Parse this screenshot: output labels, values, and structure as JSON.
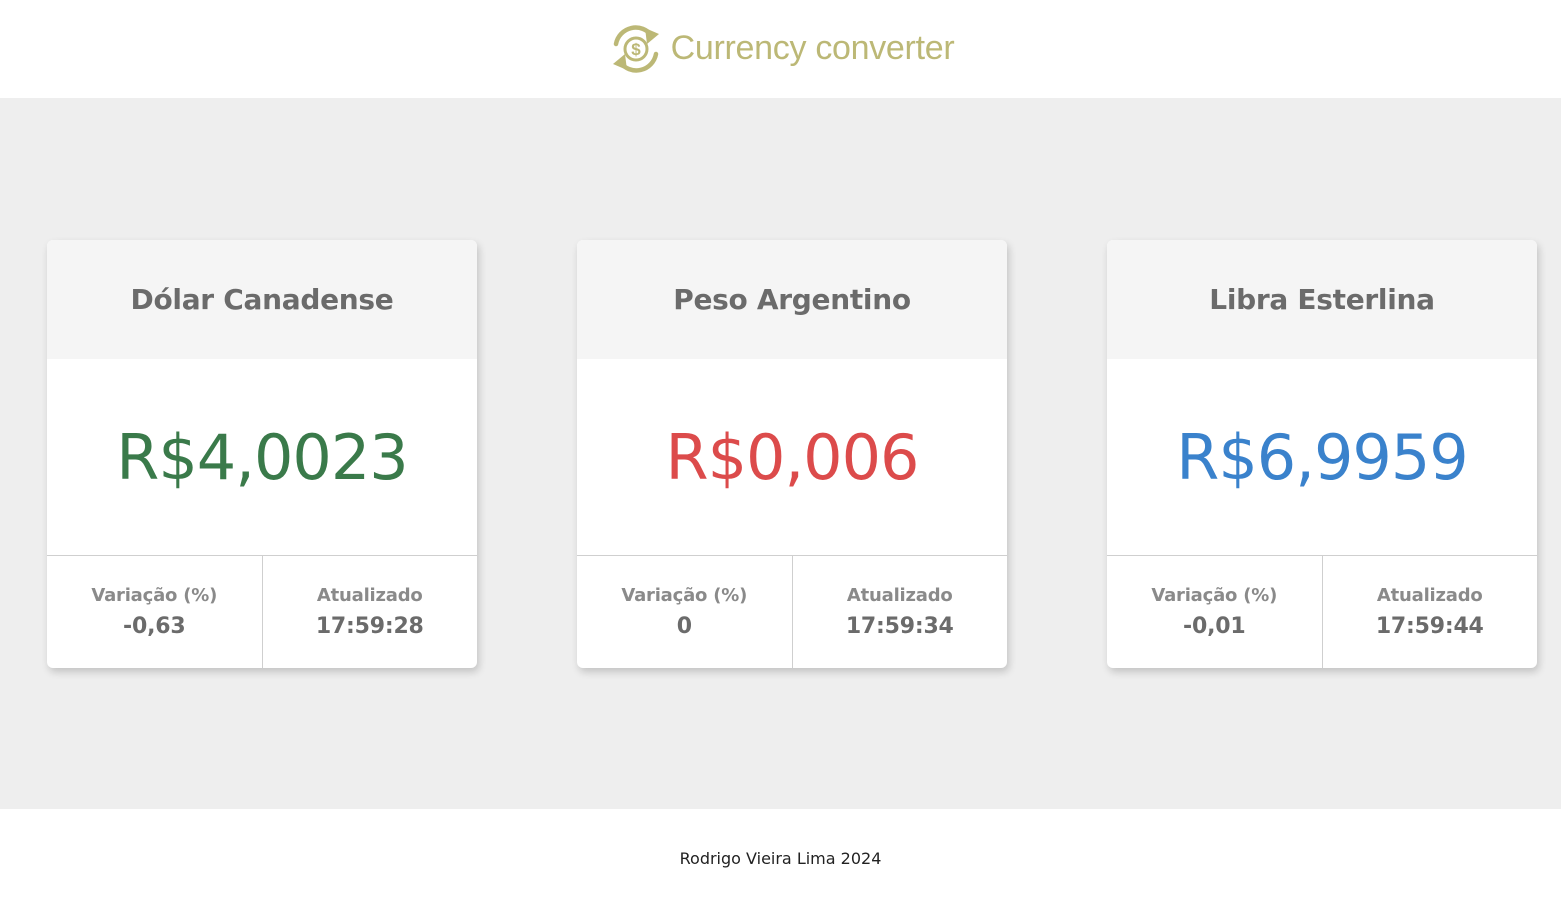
{
  "header": {
    "logo_icon": "currency-exchange-icon",
    "title": "Currency converter",
    "accent_color": "#bcb876"
  },
  "cards": [
    {
      "title": "Dólar Canadense",
      "value": "R$4,0023",
      "value_color": "#3a7a4a",
      "variation_label": "Variação (%)",
      "variation_value": "-0,63",
      "updated_label": "Atualizado",
      "updated_value": "17:59:28"
    },
    {
      "title": "Peso Argentino",
      "value": "R$0,006",
      "value_color": "#dc4b4b",
      "variation_label": "Variação (%)",
      "variation_value": "0",
      "updated_label": "Atualizado",
      "updated_value": "17:59:34"
    },
    {
      "title": "Libra Esterlina",
      "value": "R$6,9959",
      "value_color": "#3a82cc",
      "variation_label": "Variação (%)",
      "variation_value": "-0,01",
      "updated_label": "Atualizado",
      "updated_value": "17:59:44"
    }
  ],
  "footer": {
    "text": "Rodrigo Vieira Lima 2024"
  }
}
